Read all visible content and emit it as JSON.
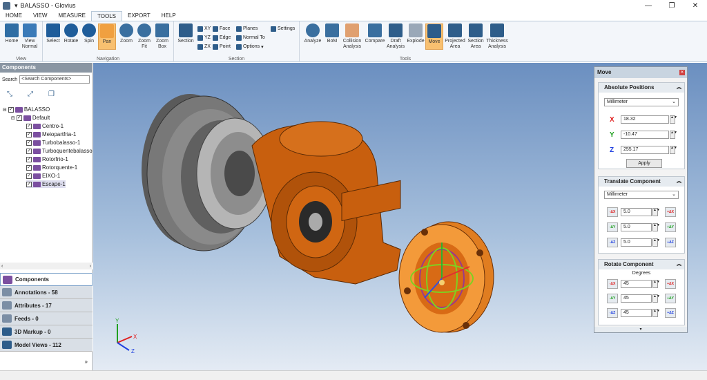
{
  "window": {
    "title": "BALASSO - Glovius",
    "qa": "▾"
  },
  "tabs": [
    "HOME",
    "VIEW",
    "MEASURE",
    "TOOLS",
    "EXPORT",
    "HELP"
  ],
  "active_tab": "TOOLS",
  "ribbon": {
    "view_group": {
      "label": "View",
      "home": "Home",
      "view_normal": "View Normal"
    },
    "navigation_group": {
      "label": "Navigation",
      "select": "Select",
      "rotate": "Rotate",
      "spin": "Spin",
      "pan": "Pan",
      "zoom": "Zoom",
      "zoom_fit": "Zoom Fit",
      "zoom_box": "Zoom Box"
    },
    "section_group": {
      "label": "Section",
      "section": "Section",
      "xy": "XY",
      "yz": "YZ",
      "zx": "ZX",
      "face": "Face",
      "edge": "Edge",
      "point": "Point",
      "planes": "Planes",
      "normal_to": "Normal To",
      "options": "Options",
      "settings": "Settings"
    },
    "tools_group": {
      "label": "Tools",
      "analyze": "Analyze",
      "bom": "BoM",
      "collision": "Collision Analysis",
      "compare": "Compare",
      "draft": "Draft Analysis",
      "explode": "Explode",
      "move": "Move",
      "projected": "Projected Area",
      "section_area": "Section Area",
      "thickness": "Thickness Analysis"
    }
  },
  "left_panel": {
    "header": "Components",
    "search_label": "Search",
    "search_placeholder": "<Search Components>",
    "tree": {
      "root": "BALASSO",
      "config": "Default",
      "items": [
        "Centro-1",
        "Meiopartfria-1",
        "Turbobalasso-1",
        "Turboquentebalasso",
        "Rotorfrio-1",
        "Rotorquente-1",
        "EIXO-1",
        "Escape-1"
      ]
    },
    "tabs": [
      "Components",
      "Annotations - 58",
      "Attributes - 17",
      "Feeds - 0",
      "3D Markup - 0",
      "Model Views - 112"
    ],
    "more": "»"
  },
  "move_panel": {
    "title": "Move",
    "absolute": {
      "header": "Absolute Positions",
      "unit": "Millimeter",
      "x_label": "X",
      "y_label": "Y",
      "z_label": "Z",
      "x": "18.32",
      "y": "-10.47",
      "z": "255.17",
      "apply": "Apply"
    },
    "translate": {
      "header": "Translate Component",
      "unit": "Millimeter",
      "values": [
        "5.0",
        "5.0",
        "5.0"
      ],
      "minus_labels": [
        "-ΔX",
        "-ΔY",
        "-ΔZ"
      ],
      "plus_labels": [
        "+ΔX",
        "+ΔY",
        "+ΔZ"
      ]
    },
    "rotate": {
      "header": "Rotate Component",
      "subheader": "Degrees",
      "values": [
        "45",
        "45",
        "45"
      ],
      "minus_labels": [
        "-ΔX",
        "-ΔY",
        "-ΔZ"
      ],
      "plus_labels": [
        "+ΔX",
        "+ΔY",
        "+ΔZ"
      ]
    }
  },
  "triad": {
    "x": "X",
    "y": "Y",
    "z": "Z"
  },
  "colors": {
    "accent": "#f8c070",
    "orange_part": "#c8600e",
    "grey_part": "#707070",
    "x_axis": "#e02020",
    "y_axis": "#20a020",
    "z_axis": "#2040e0"
  }
}
